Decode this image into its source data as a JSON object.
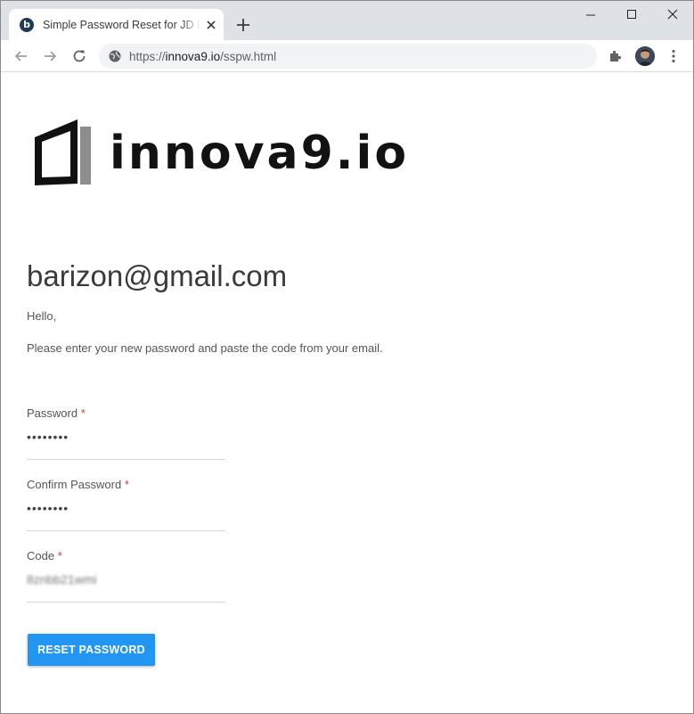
{
  "browser": {
    "tab": {
      "favicon_letter": "b",
      "title": "Simple Password Reset for JD Edwards"
    },
    "address_bar": {
      "url_scheme": "https://",
      "url_host": "innova9.io",
      "url_path": "/sspw.html"
    }
  },
  "page": {
    "logo_text": "innova9.io",
    "email_heading": "barizon@gmail.com",
    "greeting": "Hello,",
    "instructions": "Please enter your new password and paste the code from your email.",
    "form": {
      "password": {
        "label": "Password",
        "required_mark": "*",
        "value": "••••••••"
      },
      "confirm_password": {
        "label": "Confirm Password",
        "required_mark": "*",
        "value": "••••••••"
      },
      "code": {
        "label": "Code",
        "required_mark": "*",
        "value": "8znbb21wmi"
      }
    },
    "reset_button_label": "RESET PASSWORD"
  },
  "colors": {
    "primary_button": "#2196f3",
    "required": "#e53935",
    "tabstrip": "#dee1e6"
  }
}
